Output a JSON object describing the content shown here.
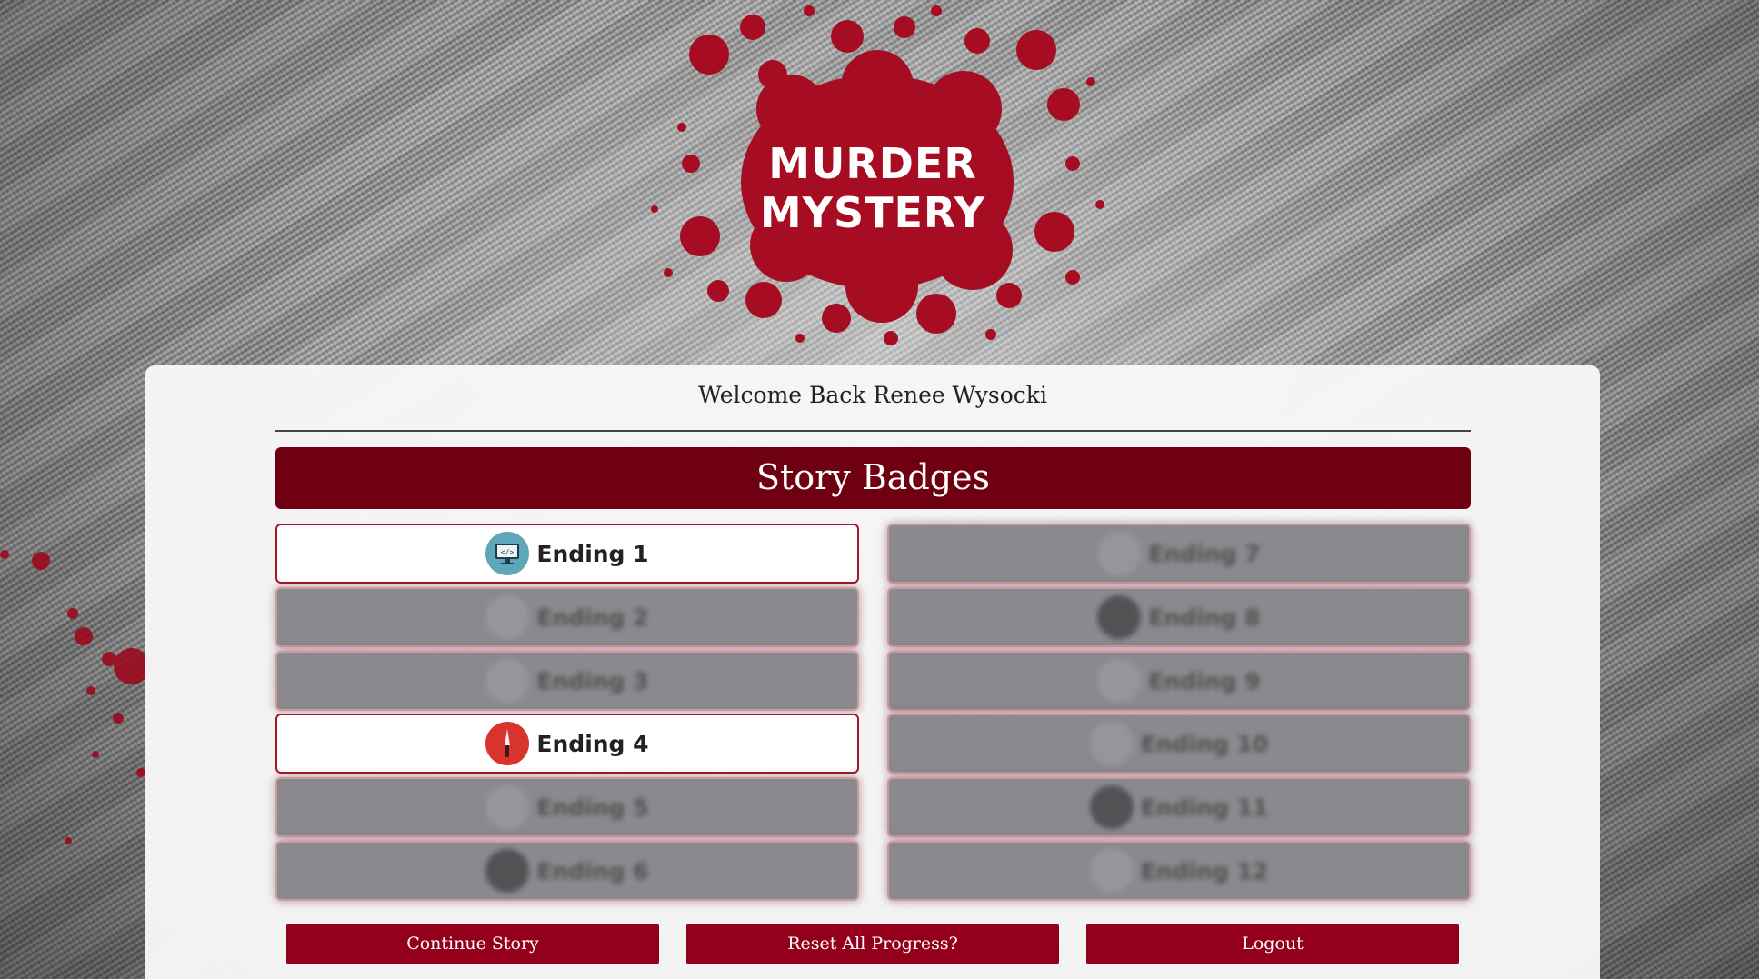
{
  "logo": {
    "line1": "MURDER",
    "line2": "MYSTERY"
  },
  "welcome_text": "Welcome Back Renee Wysocki",
  "section_title": "Story Badges",
  "colors": {
    "blood": "#b0001e",
    "banner": "#6e0012",
    "button": "#94001c"
  },
  "badges_left": [
    {
      "label": "Ending 1",
      "icon": "computer-code-icon",
      "unlocked": true
    },
    {
      "label": "Ending 2",
      "icon": "figure-icon",
      "unlocked": false
    },
    {
      "label": "Ending 3",
      "icon": "bottle-icon",
      "unlocked": false
    },
    {
      "label": "Ending 4",
      "icon": "knife-icon",
      "unlocked": true
    },
    {
      "label": "Ending 5",
      "icon": "cup-icon",
      "unlocked": false
    },
    {
      "label": "Ending 6",
      "icon": "dark-circle-icon",
      "unlocked": false
    }
  ],
  "badges_right": [
    {
      "label": "Ending 7",
      "icon": "hand-icon",
      "unlocked": false
    },
    {
      "label": "Ending 8",
      "icon": "bottle-dark-icon",
      "unlocked": false
    },
    {
      "label": "Ending 9",
      "icon": "spot-icon",
      "unlocked": false
    },
    {
      "label": "Ending 10",
      "icon": "star-icon",
      "unlocked": false
    },
    {
      "label": "Ending 11",
      "icon": "person-icon",
      "unlocked": false
    },
    {
      "label": "Ending 12",
      "icon": "glass-icon",
      "unlocked": false
    }
  ],
  "buttons": {
    "continue": "Continue Story",
    "reset": "Reset All Progress?",
    "logout": "Logout"
  }
}
